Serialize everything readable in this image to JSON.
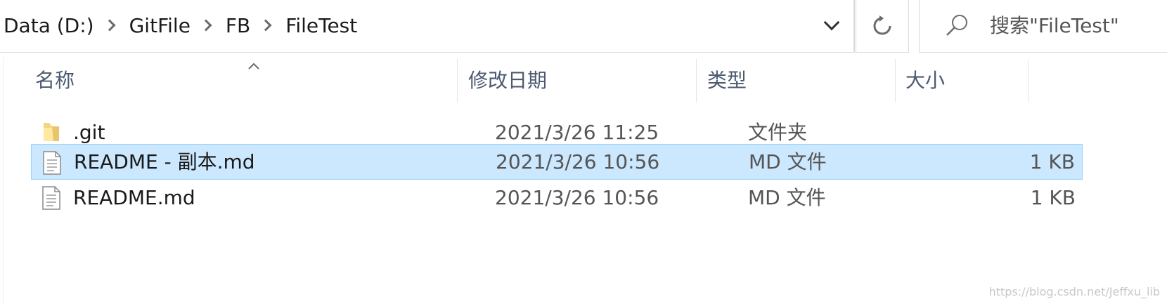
{
  "breadcrumb": [
    "Data (D:)",
    "GitFile",
    "FB",
    "FileTest"
  ],
  "search": {
    "placeholder": "搜索\"FileTest\""
  },
  "columns": {
    "name": "名称",
    "modified": "修改日期",
    "type": "类型",
    "size": "大小"
  },
  "files": [
    {
      "name": ".git",
      "modified": "2021/3/26 11:25",
      "type": "文件夹",
      "size": "",
      "icon": "folder-icon",
      "selected": false
    },
    {
      "name": "README - 副本.md",
      "modified": "2021/3/26 10:56",
      "type": "MD 文件",
      "size": "1 KB",
      "icon": "document-icon",
      "selected": true
    },
    {
      "name": "README.md",
      "modified": "2021/3/26 10:56",
      "type": "MD 文件",
      "size": "1 KB",
      "icon": "document-icon",
      "selected": false
    }
  ],
  "watermark": "https://blog.csdn.net/Jeffxu_lib",
  "colors": {
    "selection_bg": "#cce8ff",
    "selection_border": "#99d1ff",
    "header_text": "#4b5a70"
  }
}
